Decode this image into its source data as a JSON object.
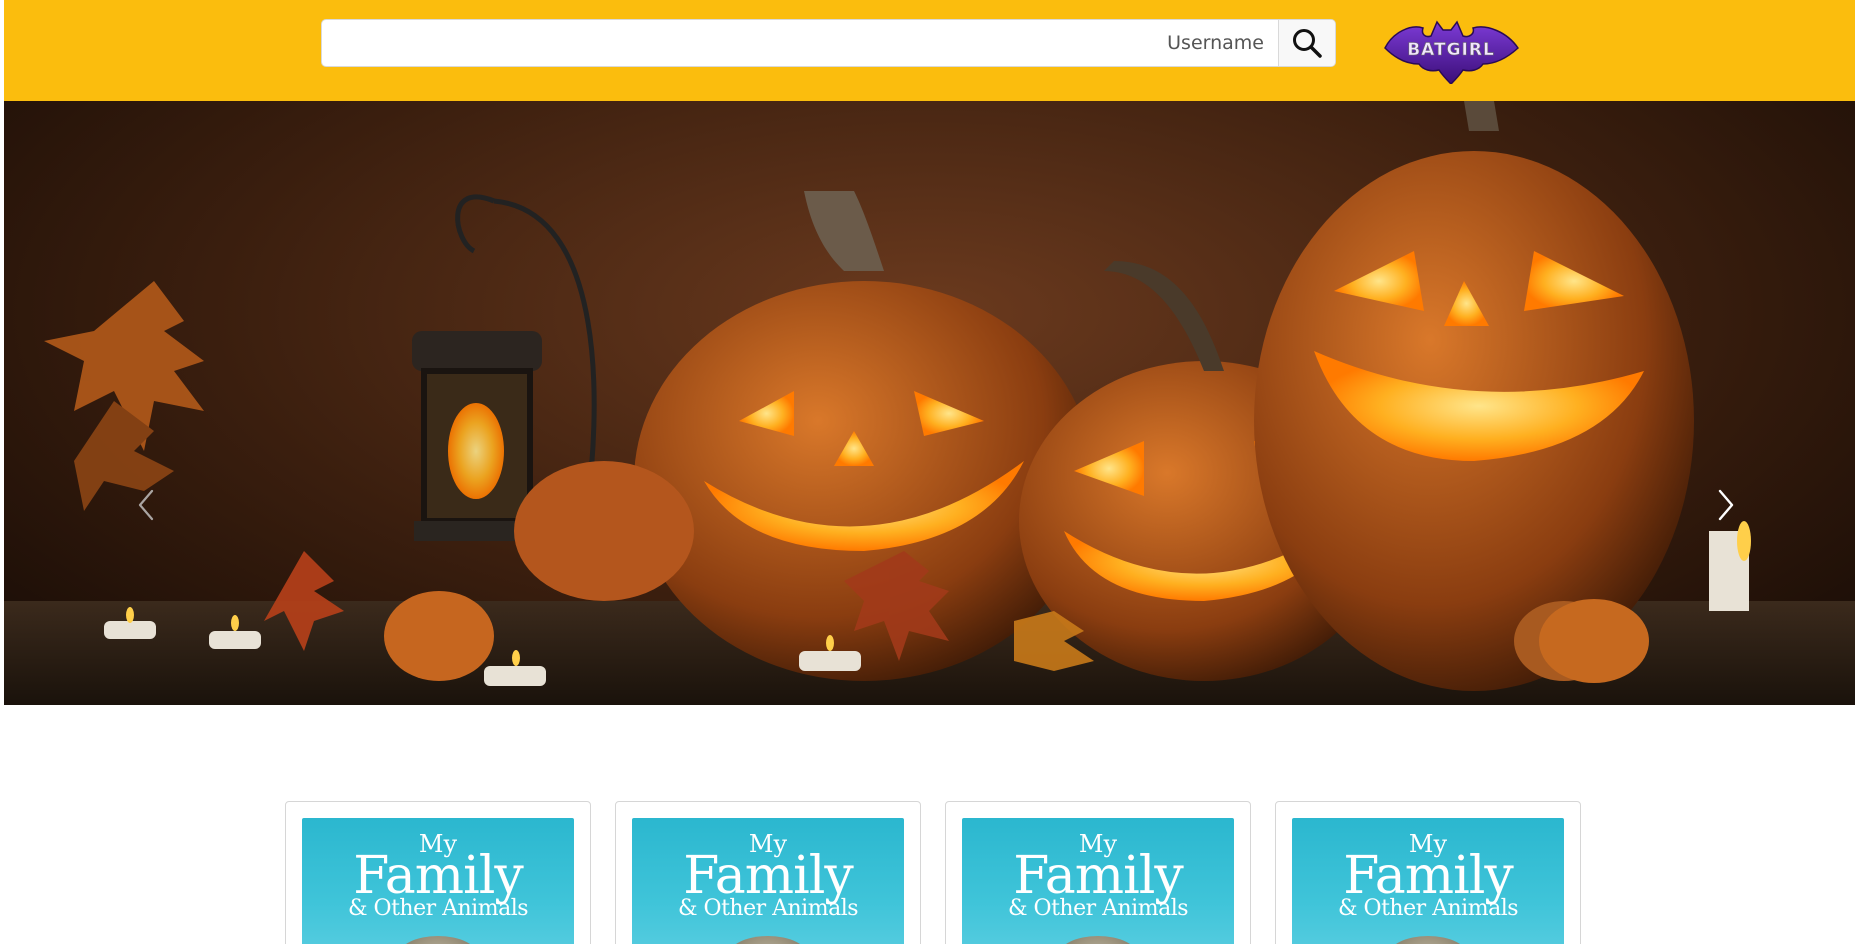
{
  "header": {
    "background": "#fbbd0d",
    "search": {
      "placeholder": "Username",
      "value": "",
      "button_icon": "search-icon"
    },
    "logo": {
      "text": "BATGIRL",
      "icon": "bat-logo"
    }
  },
  "carousel": {
    "image": "halloween-jack-o-lanterns",
    "prev_icon": "chevron-left-icon",
    "next_icon": "chevron-right-icon"
  },
  "cards": [
    {
      "title_line1": "My",
      "title_line2": "Family",
      "title_line3": "& Other Animals"
    },
    {
      "title_line1": "My",
      "title_line2": "Family",
      "title_line3": "& Other Animals"
    },
    {
      "title_line1": "My",
      "title_line2": "Family",
      "title_line3": "& Other Animals"
    },
    {
      "title_line1": "My",
      "title_line2": "Family",
      "title_line3": "& Other Animals"
    }
  ]
}
